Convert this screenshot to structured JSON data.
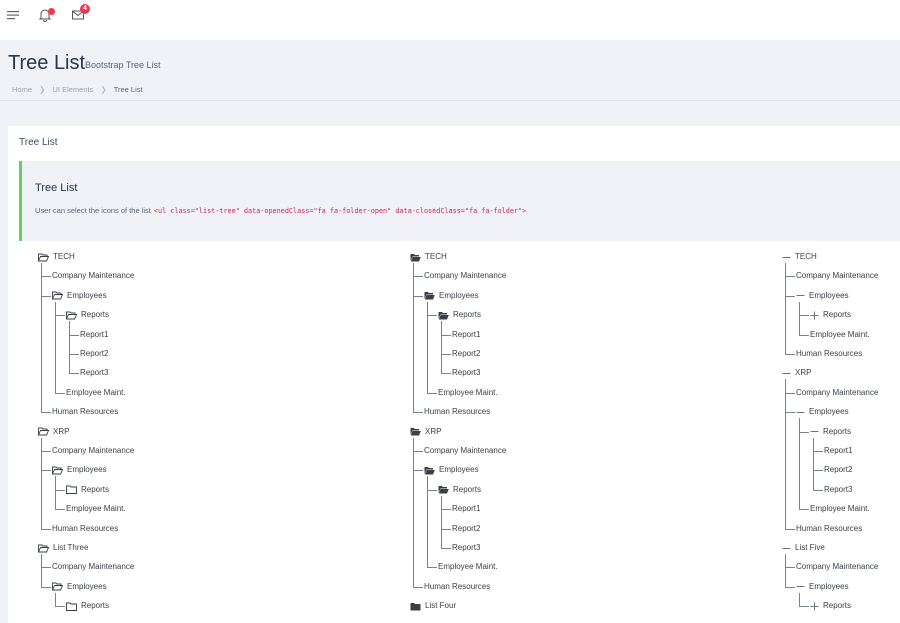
{
  "topbar": {
    "menu_icon": "hamburger-icon",
    "bell_icon": "bell-icon",
    "mail_icon": "envelope-icon",
    "mail_badge": "4"
  },
  "header": {
    "title": "Tree List",
    "subtitle": "Bootstrap Tree List",
    "breadcrumb": [
      "Home",
      "UI Elements",
      "Tree List"
    ]
  },
  "card": {
    "title": "Tree List",
    "callout": {
      "title": "Tree List",
      "text": "User can select the icons of the list",
      "code": "<ul class=\"list-tree\" data-openedClass=\"fa fa-folder-open\" data-closedClass=\"fa fa-folder\">"
    }
  },
  "colors": {
    "accent": "#5cd164",
    "badge": "#f0384f",
    "code": "#c7254e"
  },
  "trees": [
    {
      "icon_style": "folder-outline",
      "nodes": [
        {
          "label": "TECH",
          "icon": "folder-open",
          "children": [
            {
              "label": "Company Maintenance"
            },
            {
              "label": "Employees",
              "icon": "folder-open",
              "children": [
                {
                  "label": "Reports",
                  "icon": "folder-open",
                  "children": [
                    {
                      "label": "Report1"
                    },
                    {
                      "label": "Report2"
                    },
                    {
                      "label": "Report3"
                    }
                  ]
                },
                {
                  "label": "Employee Maint."
                }
              ]
            },
            {
              "label": "Human Resources"
            }
          ]
        },
        {
          "label": "XRP",
          "icon": "folder-open",
          "children": [
            {
              "label": "Company Maintenance"
            },
            {
              "label": "Employees",
              "icon": "folder-open",
              "children": [
                {
                  "label": "Reports",
                  "icon": "folder"
                },
                {
                  "label": "Employee Maint."
                }
              ]
            },
            {
              "label": "Human Resources"
            }
          ]
        },
        {
          "label": "List Three",
          "icon": "folder-open",
          "children": [
            {
              "label": "Company Maintenance"
            },
            {
              "label": "Employees",
              "icon": "folder-open",
              "children": [
                {
                  "label": "Reports",
                  "icon": "folder"
                }
              ]
            }
          ]
        }
      ]
    },
    {
      "icon_style": "folder-solid",
      "nodes": [
        {
          "label": "TECH",
          "icon": "folder-open",
          "children": [
            {
              "label": "Company Maintenance"
            },
            {
              "label": "Employees",
              "icon": "folder-open",
              "children": [
                {
                  "label": "Reports",
                  "icon": "folder-open",
                  "children": [
                    {
                      "label": "Report1"
                    },
                    {
                      "label": "Report2"
                    },
                    {
                      "label": "Report3"
                    }
                  ]
                },
                {
                  "label": "Employee Maint."
                }
              ]
            },
            {
              "label": "Human Resources"
            }
          ]
        },
        {
          "label": "XRP",
          "icon": "folder-open",
          "children": [
            {
              "label": "Company Maintenance"
            },
            {
              "label": "Employees",
              "icon": "folder-open",
              "children": [
                {
                  "label": "Reports",
                  "icon": "folder-open",
                  "children": [
                    {
                      "label": "Report1"
                    },
                    {
                      "label": "Report2"
                    },
                    {
                      "label": "Report3"
                    }
                  ]
                },
                {
                  "label": "Employee Maint."
                }
              ]
            },
            {
              "label": "Human Resources"
            }
          ]
        },
        {
          "label": "List Four",
          "icon": "folder"
        }
      ]
    },
    {
      "icon_style": "plus-minus",
      "nodes": [
        {
          "label": "TECH",
          "icon": "minus",
          "children": [
            {
              "label": "Company Maintenance"
            },
            {
              "label": "Employees",
              "icon": "minus",
              "children": [
                {
                  "label": "Reports",
                  "icon": "plus"
                },
                {
                  "label": "Employee Maint."
                }
              ]
            },
            {
              "label": "Human Resources"
            }
          ]
        },
        {
          "label": "XRP",
          "icon": "minus",
          "children": [
            {
              "label": "Company Maintenance"
            },
            {
              "label": "Employees",
              "icon": "minus",
              "children": [
                {
                  "label": "Reports",
                  "icon": "minus",
                  "children": [
                    {
                      "label": "Report1"
                    },
                    {
                      "label": "Report2"
                    },
                    {
                      "label": "Report3"
                    }
                  ]
                },
                {
                  "label": "Employee Maint."
                }
              ]
            },
            {
              "label": "Human Resources"
            }
          ]
        },
        {
          "label": "List Five",
          "icon": "minus",
          "children": [
            {
              "label": "Company Maintenance"
            },
            {
              "label": "Employees",
              "icon": "minus",
              "children": [
                {
                  "label": "Reports",
                  "icon": "plus"
                }
              ]
            }
          ]
        }
      ]
    }
  ]
}
